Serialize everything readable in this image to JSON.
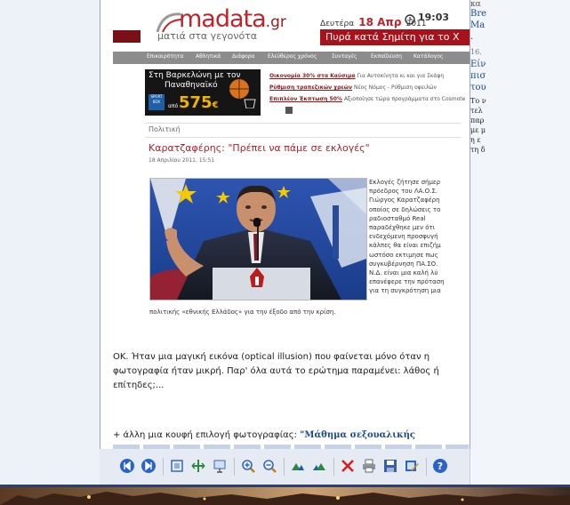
{
  "right_panel": {
    "lines": [
      "κα",
      "Bre",
      "Ma",
      ".",
      "16.",
      "Είν",
      "πισ",
      "του",
      "Το ν",
      "τελ",
      "παρ",
      "με μ",
      "η ε",
      "τη δ"
    ]
  },
  "header": {
    "logo": "madata",
    "logo_suffix": ".gr",
    "tagline": "ματιά στα γεγονότα",
    "date_prefix": "Δευτέρα",
    "date_main": "18 Απρ",
    "date_year": "2011",
    "time": "19:03",
    "breaking": "Πυρά κατά Σημίτη για το Χ"
  },
  "nav": {
    "items": [
      "Επικαιρότητα",
      "Αθλητικά",
      "Διάφορα",
      "Ελεύθερος χρόνος",
      "Συνταγές",
      "Εκπαίδευση",
      "Κατάλογος"
    ]
  },
  "ad": {
    "line1": "Στη Βαρκελώνη με τον",
    "line2": "Παναθηναϊκό",
    "badge": "SPORT BOX",
    "apo": "από",
    "price": "575",
    "currency": "€"
  },
  "links": [
    {
      "bold": "Οικονομία 30% στα Καύσιμα",
      "rest": "Για Αυτοκίνητα κι και για Σκάφη"
    },
    {
      "bold": "Ρύθμιση τραπεζικών χρεών",
      "rest": "Νέος Νόμος - Ρύθμιση οφειλών"
    },
    {
      "bold": "Επιπλέον Έκπτωση 50%",
      "rest": "Αξιοποίησε τώρα προγράμματα στο Cosmote"
    }
  ],
  "article": {
    "category": "Πολιτική",
    "headline": "Καρατζαφέρης: \"Πρέπει να πάμε σε εκλογές\"",
    "date": "18 Απριλίου 2011, 15:51",
    "body": [
      "Εκλογές ζήτησε σήμερ",
      "πρόεδρος του ΛΑ.Ο.Σ.",
      "Γιώργος Καρατζαφέρη",
      "οποίος σε δηλώσεις το",
      "ραδιοσταθμό Real",
      "παραδέχθηκε μεν ότι",
      "ενδεχόμενη προσφυγή",
      "κάλπες θα είναι επιζήμ",
      "ωστόσο εκτιμησε πως",
      "συγκυβέρνηση ΠΑ.ΣΟ.",
      "Ν.Δ. είναι μια καλή λύ",
      "επανέφερε την πρόταση",
      "για τη συγκρότηση μια"
    ],
    "caption": "πολιτικής «εθνικής Ελλάδος» για την έξοδο από την κρίση."
  },
  "comment": {
    "text": "ΟΚ. Ήταν μια μαγική εικόνα (optical illusion) που φαίνεται μόνο όταν η φωτογραφία ήταν μικρή. Παρ' όλα αυτά το ερώτημα παραμένει: λάθος ή επίτηδες;...",
    "footer_prefix": "+ άλλη μια κουφή επιλογή φωτογραφίας: ",
    "footer_link": "\"Μάθημα σεξουαλικής"
  },
  "toolbar": {
    "buttons": [
      "previous-icon",
      "next-icon",
      "fit-page-icon",
      "fit-width-icon",
      "slideshow-icon",
      "zoom-in-icon",
      "zoom-out-icon",
      "rotate-left-icon",
      "rotate-right-icon",
      "delete-icon",
      "print-icon",
      "save-icon",
      "edit-icon",
      "help-icon"
    ]
  },
  "colors": {
    "brand_red": "#c0242a",
    "breaking_bar": "#a8121a",
    "nav_gray": "#8c8c8c",
    "link_blue": "#1d4a83"
  }
}
